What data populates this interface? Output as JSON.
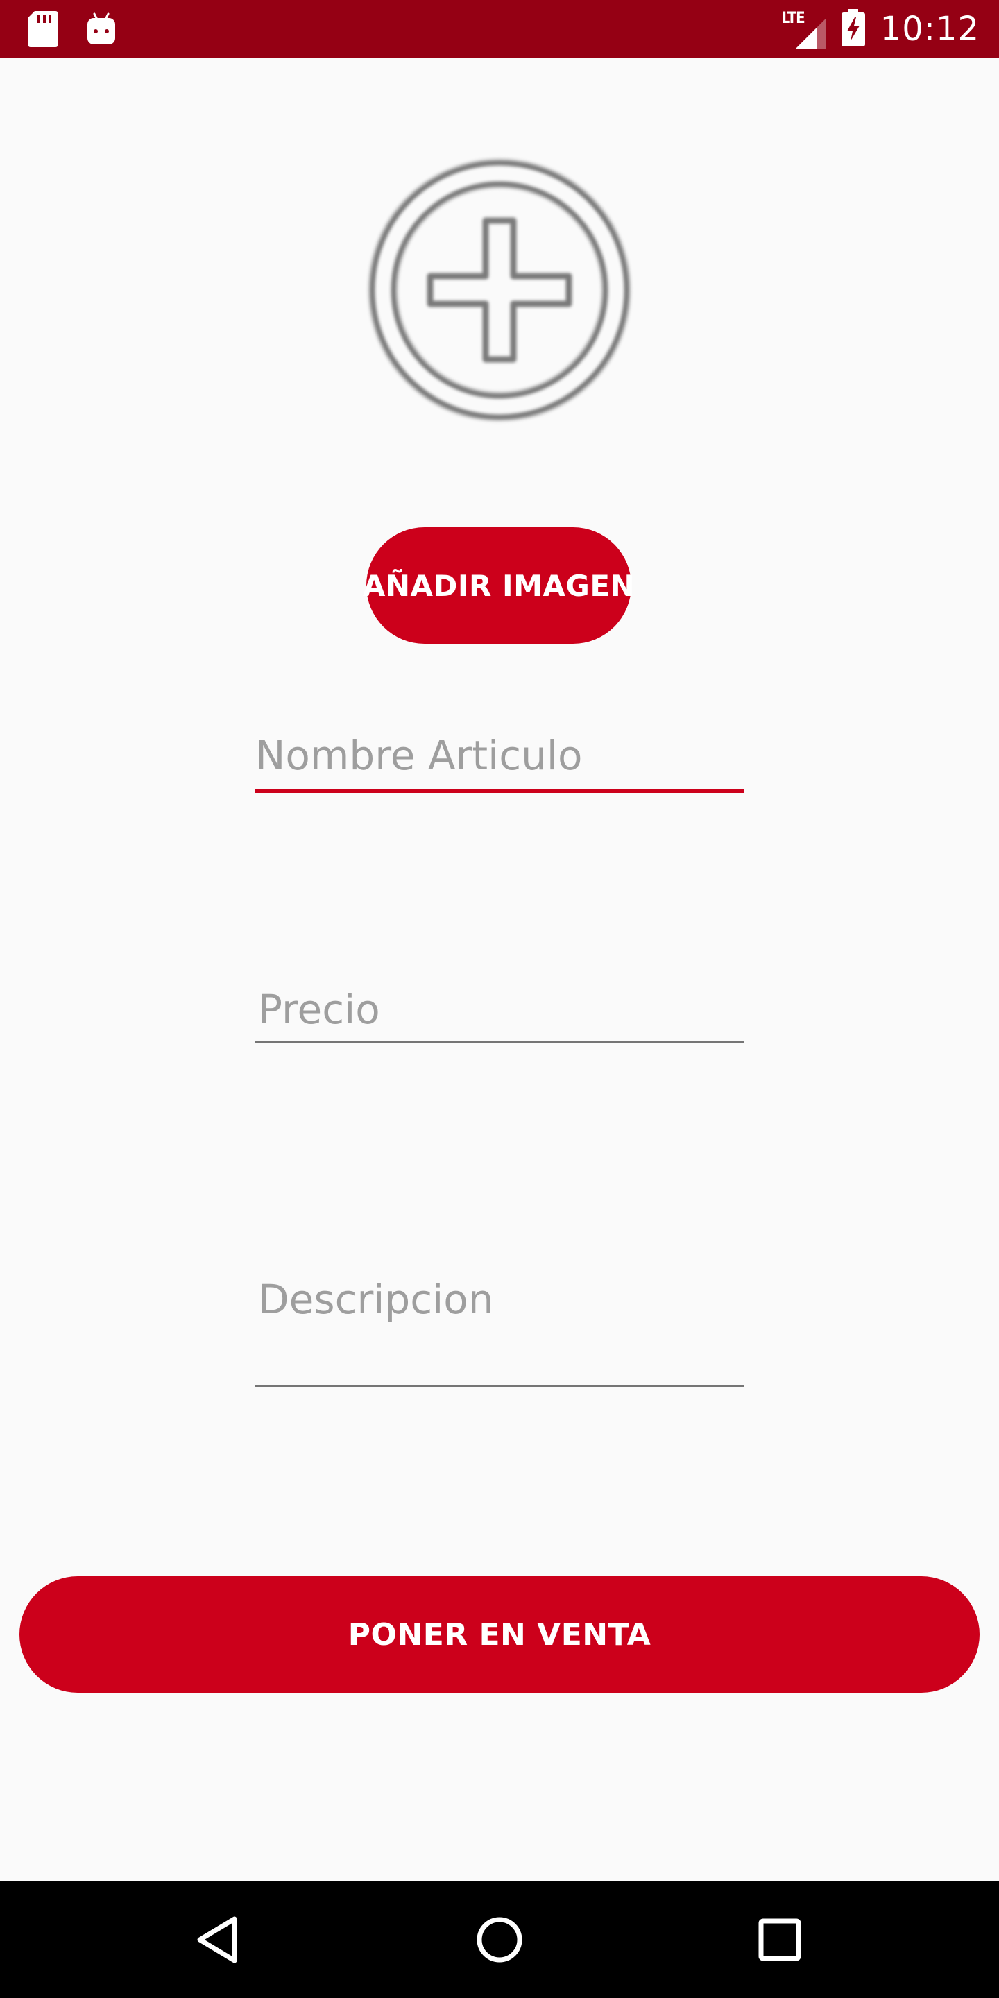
{
  "status_bar": {
    "time": "10:12",
    "network": "LTE",
    "icons": [
      "sd-card-icon",
      "android-icon",
      "lte-signal-icon",
      "battery-charging-icon"
    ]
  },
  "image_picker": {
    "icon": "add-circle-icon"
  },
  "add_image_button": {
    "label": "AÑADIR IMAGEN"
  },
  "form": {
    "name_field": {
      "placeholder": "Nombre Articulo",
      "value": ""
    },
    "price_field": {
      "placeholder": "Precio",
      "value": ""
    },
    "description_field": {
      "placeholder": "Descripcion",
      "value": ""
    }
  },
  "sell_button": {
    "label": "PONER EN VENTA"
  },
  "nav_bar": {
    "icons": [
      "back-icon",
      "home-icon",
      "recents-icon"
    ]
  },
  "colors": {
    "status_bar": "#950014",
    "accent": "#CC001B",
    "background": "#FAFAFA",
    "hint_text": "#9E9E9E",
    "underline": "#757575",
    "nav_bar": "#000000"
  }
}
